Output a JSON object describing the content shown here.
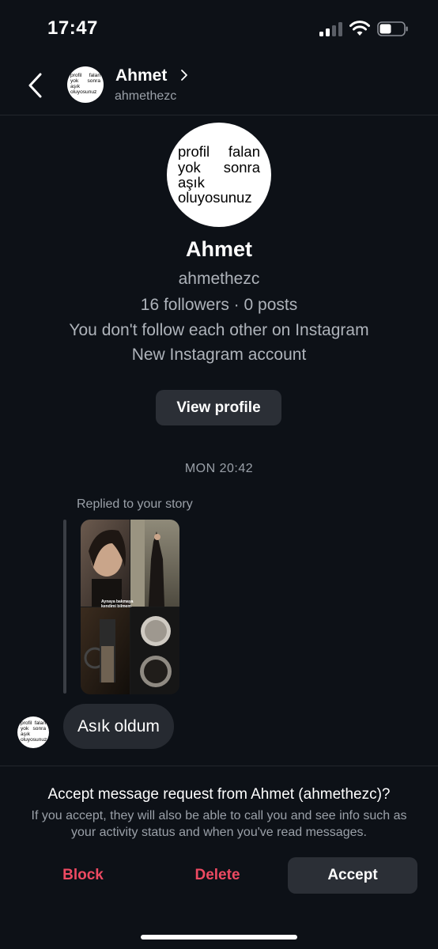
{
  "status_bar": {
    "time": "17:47"
  },
  "header": {
    "name": "Ahmet",
    "handle": "ahmethezc"
  },
  "avatar_text": [
    "profil",
    "falan",
    "yok",
    "sonra",
    "aşık",
    "oluyosunuz"
  ],
  "profile": {
    "name": "Ahmet",
    "handle": "ahmethezc",
    "stats": "16 followers · 0 posts",
    "mutual": "You don't follow each other on Instagram",
    "note": "New Instagram account",
    "view_button": "View profile"
  },
  "thread": {
    "timestamp": "MON 20:42",
    "replied_label": "Replied to your story",
    "story_caption": [
      "Aynaya bakmaya",
      "kendimi bilmem"
    ],
    "message": "Asık oldum"
  },
  "request": {
    "title": "Accept message request from Ahmet (ahmethezc)?",
    "description": "If you accept, they will also be able to call you and see info such as your activity status and when you've read messages.",
    "block": "Block",
    "delete": "Delete",
    "accept": "Accept"
  },
  "colors": {
    "background": "#0d1117",
    "destructive": "#ed4a62",
    "button": "#2b2f36"
  },
  "icons": [
    "signal-icon",
    "wifi-icon",
    "battery-icon",
    "back-arrow-icon",
    "chevron-right-icon"
  ]
}
